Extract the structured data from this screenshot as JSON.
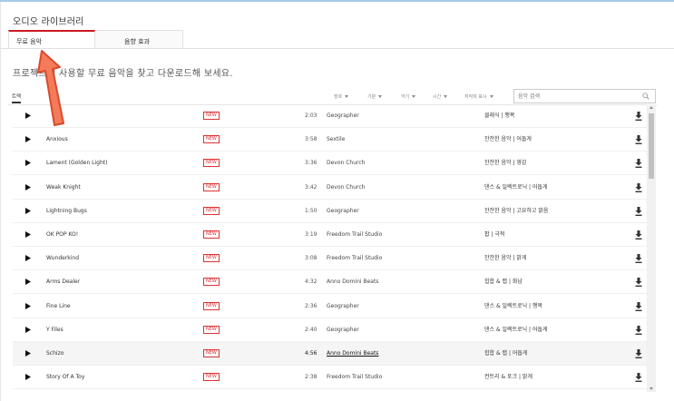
{
  "page": {
    "title": "오디오 라이브러리"
  },
  "tabs": [
    {
      "label": "무료 음악",
      "active": true
    },
    {
      "label": "음향 효과",
      "active": false
    }
  ],
  "subtitle": "프로젝트에 사용할 무료 음악을 찾고 다운로드해 보세요.",
  "toolbar": {
    "track_tab": "트랙",
    "filters": [
      {
        "label": "장르"
      },
      {
        "label": "기분"
      },
      {
        "label": "악기"
      },
      {
        "label": "시간"
      },
      {
        "label": "저작자 표시"
      }
    ],
    "search_placeholder": "음악 검색"
  },
  "tracks": [
    {
      "title": "",
      "badge": "NEW",
      "duration": "2:03",
      "artist": "Geographer",
      "genre": "클래식 | 행복"
    },
    {
      "title": "Anxious",
      "badge": "NEW",
      "duration": "3:58",
      "artist": "Sextile",
      "genre": "잔잔한 음악 | 어둡게"
    },
    {
      "title": "Lament (Golden Light)",
      "badge": "NEW",
      "duration": "3:36",
      "artist": "Devon Church",
      "genre": "잔잔한 음악 | 영감"
    },
    {
      "title": "Weak Knight",
      "badge": "NEW",
      "duration": "3:42",
      "artist": "Devon Church",
      "genre": "댄스 & 일렉트로닉 | 어둡게"
    },
    {
      "title": "Lightning Bugs",
      "badge": "NEW",
      "duration": "1:50",
      "artist": "Geographer",
      "genre": "잔잔한 음악 | 고요하고 맑음"
    },
    {
      "title": "OK POP KO!",
      "badge": "NEW",
      "duration": "3:19",
      "artist": "Freedom Trail Studio",
      "genre": "팝 | 극적"
    },
    {
      "title": "Wunderkind",
      "badge": "NEW",
      "duration": "3:08",
      "artist": "Freedom Trail Studio",
      "genre": "잔잔한 음악 | 밝게"
    },
    {
      "title": "Arms Dealer",
      "badge": "NEW",
      "duration": "4:32",
      "artist": "Anno Domini Beats",
      "genre": "힙합 & 랩 | 화남"
    },
    {
      "title": "Fine Line",
      "badge": "NEW",
      "duration": "2:36",
      "artist": "Geographer",
      "genre": "댄스 & 일렉트로닉 | 행복"
    },
    {
      "title": "Y Files",
      "badge": "NEW",
      "duration": "2:40",
      "artist": "Geographer",
      "genre": "댄스 & 일렉트로닉 | 어둡게"
    },
    {
      "title": "Schizo",
      "badge": "NEW",
      "duration": "4:56",
      "artist": "Anno Domini Beats",
      "genre": "힙합 & 랩 | 어둡게",
      "hover": true
    },
    {
      "title": "Story Of A Toy",
      "badge": "NEW",
      "duration": "2:38",
      "artist": "Freedom Trail Studio",
      "genre": "컨트리 & 포크 | 밝게"
    }
  ],
  "icons": {
    "play": "play-icon",
    "download": "download-icon",
    "search": "search-icon",
    "annotation": "arrow-annotation-icon"
  },
  "colors": {
    "accent": "#cc181e",
    "badge": "#dd3333",
    "annotation_arrow": "#f26b4a"
  }
}
